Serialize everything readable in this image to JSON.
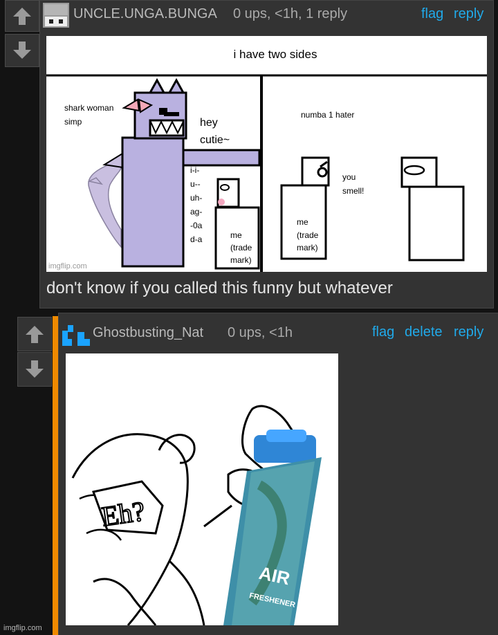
{
  "comment1": {
    "username": "UNCLE.UNGA.BUNGA",
    "meta": "0 ups, <1h, 1 reply",
    "actions": {
      "flag": "flag",
      "reply": "reply"
    },
    "caption": "don't know if you called this funny but whatever",
    "meme": {
      "header": "i have two sides",
      "labels": {
        "shark_woman_simp": [
          "shark woman",
          "simp"
        ],
        "hey_cutie": [
          "hey",
          "cutie~"
        ],
        "stutter": [
          "i-i-",
          "u--",
          "uh-",
          "ag-",
          "-0a",
          "d-a"
        ],
        "me_left": [
          "me",
          "(trade",
          "mark)"
        ],
        "numba_hater": "numba 1 hater",
        "you_smell": [
          "you",
          "smell!"
        ],
        "me_right": [
          "me",
          "(trade",
          "mark)"
        ]
      },
      "watermark": "imgflip.com"
    }
  },
  "comment2": {
    "username": "Ghostbusting_Nat",
    "meta": "0 ups, <1h",
    "actions": {
      "flag": "flag",
      "delete": "delete",
      "reply": "reply"
    },
    "meme": {
      "sign_text": "Eh?",
      "can_text": "AIR",
      "can_subtext": "FRESHENER"
    }
  },
  "footer_watermark": "imgflip.com",
  "colors": {
    "link": "#20aaea",
    "reply_accent": "#f08a00",
    "panel": "#333333",
    "page": "#131313"
  }
}
